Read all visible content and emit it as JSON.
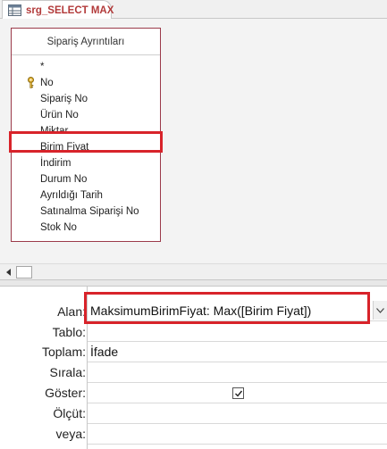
{
  "tab": {
    "title": "srg_SELECT MAX",
    "icon": "query-icon"
  },
  "table": {
    "title": "Sipariş Ayrıntıları",
    "fields": [
      {
        "label": "*",
        "key": false
      },
      {
        "label": "No",
        "key": true
      },
      {
        "label": "Sipariş No",
        "key": false
      },
      {
        "label": "Ürün No",
        "key": false
      },
      {
        "label": "Miktar",
        "key": false
      },
      {
        "label": "Birim Fiyat",
        "key": false
      },
      {
        "label": "İndirim",
        "key": false
      },
      {
        "label": "Durum No",
        "key": false
      },
      {
        "label": "Ayrıldığı Tarih",
        "key": false
      },
      {
        "label": "Satınalma Siparişi No",
        "key": false
      },
      {
        "label": "Stok No",
        "key": false
      }
    ]
  },
  "grid": {
    "rows": [
      {
        "label": "Alan:",
        "value": "MaksimumBirimFiyat: Max([Birim Fiyat])"
      },
      {
        "label": "Tablo:",
        "value": ""
      },
      {
        "label": "Toplam:",
        "value": "İfade"
      },
      {
        "label": "Sırala:",
        "value": ""
      },
      {
        "label": "Göster:",
        "value": "",
        "checked": true
      },
      {
        "label": "Ölçüt:",
        "value": ""
      },
      {
        "label": "veya:",
        "value": ""
      }
    ]
  },
  "colors": {
    "highlight": "#d8232a",
    "table_border": "#9b3a4a",
    "tab_title": "#b23a3a"
  }
}
